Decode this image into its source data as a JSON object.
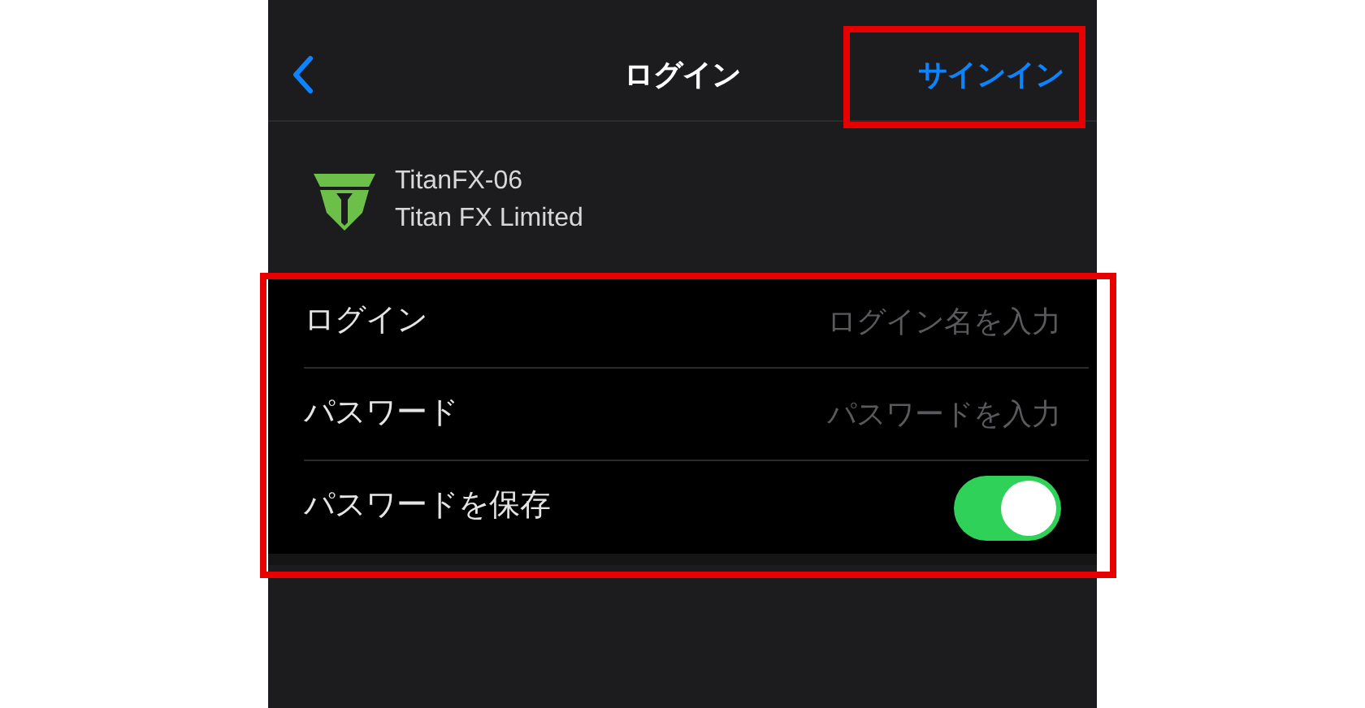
{
  "nav": {
    "title": "ログイン",
    "action": {
      "label": "サインイン",
      "highlighted": true
    }
  },
  "server": {
    "name": "TitanFX-06",
    "company": "Titan FX Limited"
  },
  "form": {
    "highlighted": true,
    "rows": [
      {
        "kind": "field",
        "label": "ログイン",
        "placeholder": "ログイン名を入力"
      },
      {
        "kind": "field",
        "label": "パスワード",
        "placeholder": "パスワードを入力"
      },
      {
        "kind": "toggle",
        "label": "パスワードを保存",
        "on": true
      }
    ]
  }
}
